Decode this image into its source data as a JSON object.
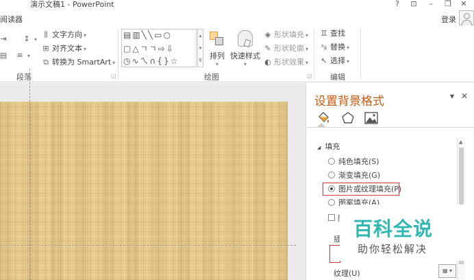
{
  "window": {
    "title": "演示文稿1 - PowerPoint",
    "help": "?",
    "restore_ribbon": "⊡",
    "minimize": "–",
    "maximize": "❐",
    "close": "✕"
  },
  "tabs": {
    "reader": "阅读器",
    "login": "登录"
  },
  "ribbon": {
    "paragraph": {
      "label": "段落",
      "text_direction": "文字方向",
      "align_text": "对齐文本",
      "convert_smartart": "转换为 SmartArt"
    },
    "drawing": {
      "label": "绘图",
      "arrange": "排列",
      "quick_styles": "快速样式",
      "shape_fill": "形状填充",
      "shape_outline": "形状轮廓",
      "shape_effects": "形状效果"
    },
    "editing": {
      "label": "编辑",
      "find": "查找",
      "replace": "替换",
      "select": "选择"
    }
  },
  "pane": {
    "title": "设置背景格式",
    "dropdown": "▾",
    "close": "✕",
    "tabs": [
      "fill-tab",
      "effects-tab",
      "picture-tab"
    ],
    "fill_section": "填充",
    "options": [
      {
        "label": "纯色填充(S)",
        "selected": false
      },
      {
        "label": "渐变填充(G)",
        "selected": false
      },
      {
        "label": "图片或纹理填充(P)",
        "selected": true
      },
      {
        "label": "图案填充(A)",
        "selected": false
      }
    ],
    "checkbox_label": "隐",
    "insert_label": "插",
    "texture_label": "纹理(U)"
  },
  "watermark": {
    "main": "百科全说",
    "sub": "助你轻松解决"
  },
  "colors": {
    "accent": "#c55a11",
    "highlight": "#d03a3a",
    "watermark": "#30b7b2",
    "slide": "#e6c98c"
  }
}
